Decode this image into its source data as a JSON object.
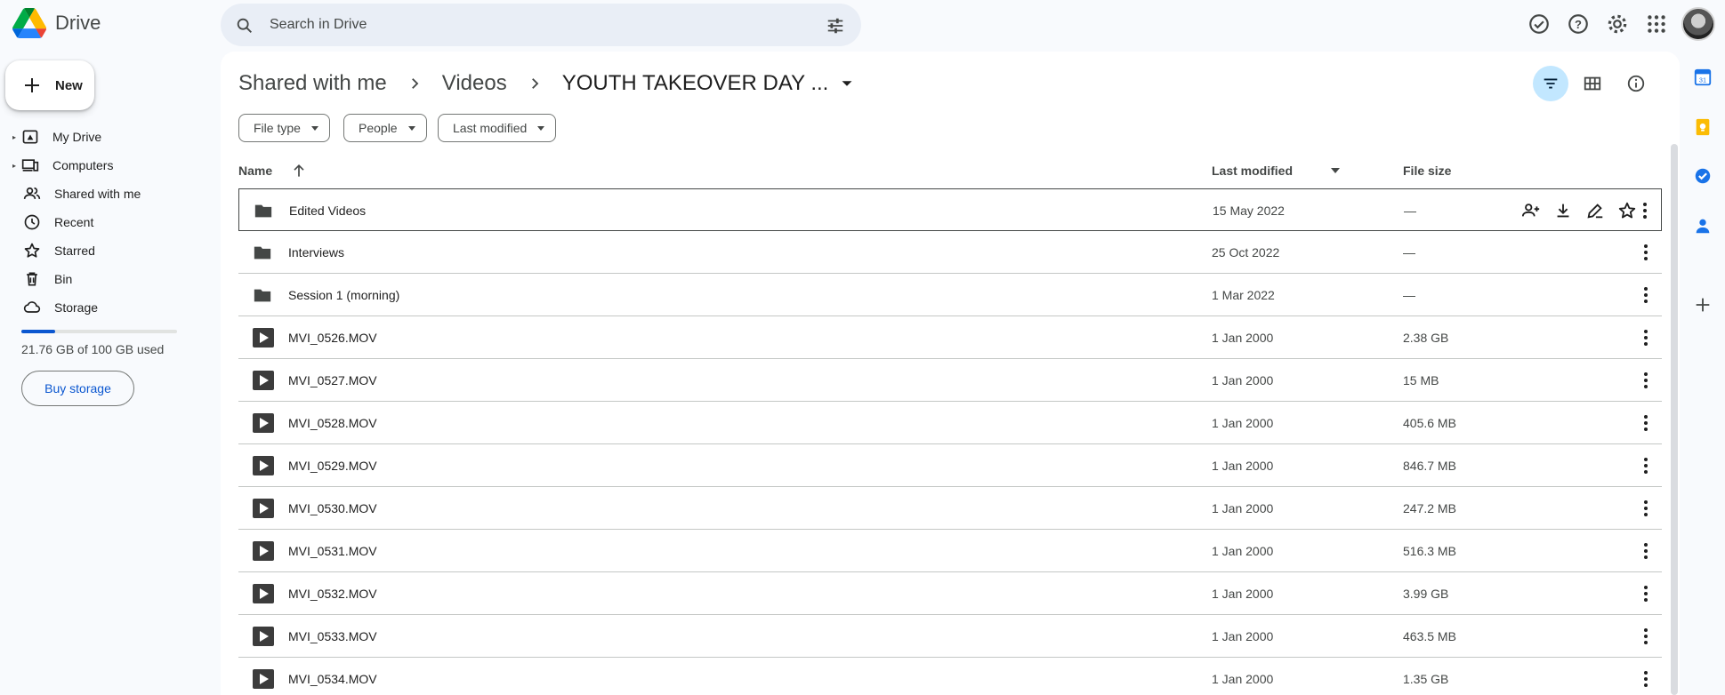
{
  "app": {
    "title": "Drive"
  },
  "search": {
    "placeholder": "Search in Drive"
  },
  "sidebar": {
    "new_label": "New",
    "items": [
      {
        "label": "My Drive",
        "icon": "my-drive-icon"
      },
      {
        "label": "Computers",
        "icon": "computers-icon"
      },
      {
        "label": "Shared with me",
        "icon": "shared-icon"
      },
      {
        "label": "Recent",
        "icon": "clock-icon"
      },
      {
        "label": "Starred",
        "icon": "star-icon"
      },
      {
        "label": "Bin",
        "icon": "trash-icon"
      },
      {
        "label": "Storage",
        "icon": "cloud-icon"
      }
    ],
    "storage_text": "21.76 GB of 100 GB used",
    "storage_used_fraction": 0.2176,
    "buy_label": "Buy storage"
  },
  "breadcrumb": {
    "root": "Shared with me",
    "mid": "Videos",
    "current": "YOUTH TAKEOVER DAY ..."
  },
  "filters": {
    "type": "File type",
    "people": "People",
    "modified": "Last modified"
  },
  "table": {
    "headers": {
      "name": "Name",
      "modified": "Last modified",
      "size": "File size"
    },
    "rows": [
      {
        "name": "Edited Videos",
        "modified": "15 May 2022",
        "size": "—",
        "kind": "folder"
      },
      {
        "name": "Interviews",
        "modified": "25 Oct 2022",
        "size": "—",
        "kind": "folder"
      },
      {
        "name": "Session 1 (morning)",
        "modified": "1 Mar 2022",
        "size": "—",
        "kind": "folder"
      },
      {
        "name": "MVI_0526.MOV",
        "modified": "1 Jan 2000",
        "size": "2.38 GB",
        "kind": "video"
      },
      {
        "name": "MVI_0527.MOV",
        "modified": "1 Jan 2000",
        "size": "15 MB",
        "kind": "video"
      },
      {
        "name": "MVI_0528.MOV",
        "modified": "1 Jan 2000",
        "size": "405.6 MB",
        "kind": "video"
      },
      {
        "name": "MVI_0529.MOV",
        "modified": "1 Jan 2000",
        "size": "846.7 MB",
        "kind": "video"
      },
      {
        "name": "MVI_0530.MOV",
        "modified": "1 Jan 2000",
        "size": "247.2 MB",
        "kind": "video"
      },
      {
        "name": "MVI_0531.MOV",
        "modified": "1 Jan 2000",
        "size": "516.3 MB",
        "kind": "video"
      },
      {
        "name": "MVI_0532.MOV",
        "modified": "1 Jan 2000",
        "size": "3.99 GB",
        "kind": "video"
      },
      {
        "name": "MVI_0533.MOV",
        "modified": "1 Jan 2000",
        "size": "463.5 MB",
        "kind": "video"
      },
      {
        "name": "MVI_0534.MOV",
        "modified": "1 Jan 2000",
        "size": "1.35 GB",
        "kind": "video"
      }
    ]
  },
  "colors": {
    "accent": "#0b57d0",
    "active_view": "#c2e7ff",
    "background": "#f8fafd"
  }
}
